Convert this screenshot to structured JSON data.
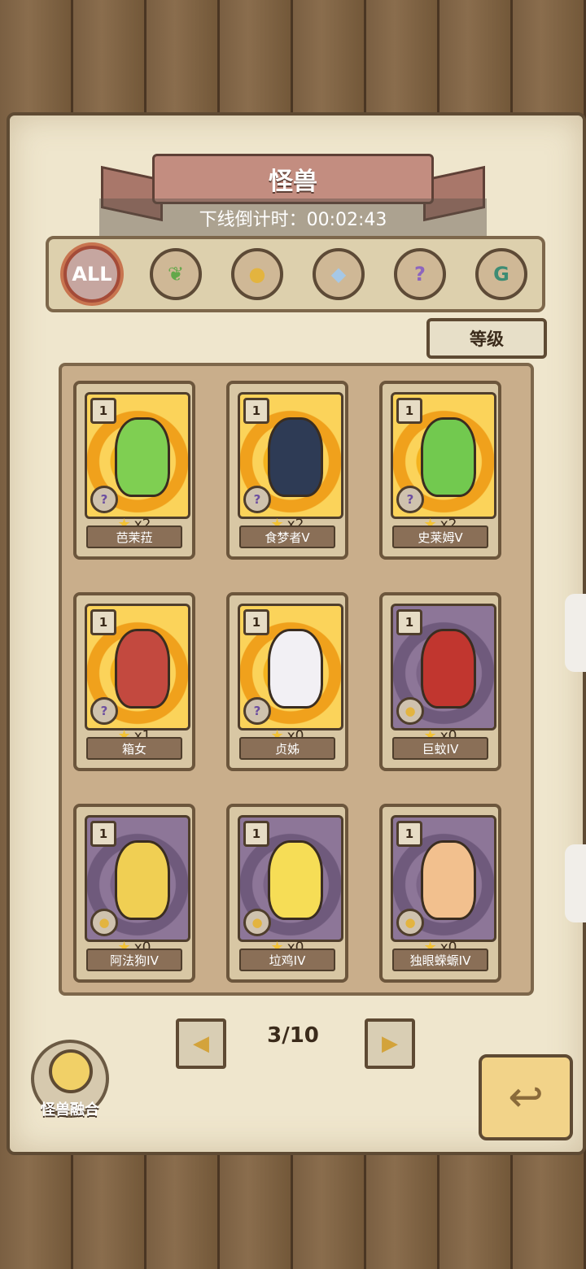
{
  "header": {
    "title": "怪兽",
    "countdown": "下线倒计时：00:02:43"
  },
  "filters": [
    {
      "label": "ALL",
      "icon": "all-icon",
      "active": true
    },
    {
      "label": "",
      "icon": "leaf-icon",
      "active": false
    },
    {
      "label": "",
      "icon": "paw-icon",
      "active": false
    },
    {
      "label": "",
      "icon": "crystal-icon",
      "active": false
    },
    {
      "label": "",
      "icon": "question-icon",
      "active": false
    },
    {
      "label": "",
      "icon": "green-gem-icon",
      "active": false
    }
  ],
  "sort": {
    "label": "等级"
  },
  "cards": [
    {
      "level": "1",
      "count": "x2",
      "name": "芭茉菈",
      "type": "?",
      "art": "gold",
      "color": "#7fcf52"
    },
    {
      "level": "1",
      "count": "x2",
      "name": "食梦者V",
      "type": "?",
      "art": "gold",
      "color": "#2e3b55"
    },
    {
      "level": "1",
      "count": "x2",
      "name": "史莱姆V",
      "type": "?",
      "art": "gold",
      "color": "#72c94f"
    },
    {
      "level": "1",
      "count": "x1",
      "name": "箱女",
      "type": "?",
      "art": "gold",
      "color": "#c3493f"
    },
    {
      "level": "1",
      "count": "x0",
      "name": "贞姊",
      "type": "?",
      "art": "gold",
      "color": "#f2f0f4"
    },
    {
      "level": "1",
      "count": "x0",
      "name": "巨蚊IV",
      "type": "paw",
      "art": "purple",
      "color": "#c1362f"
    },
    {
      "level": "1",
      "count": "x0",
      "name": "阿法狗IV",
      "type": "paw",
      "art": "purple",
      "color": "#f0cf53"
    },
    {
      "level": "1",
      "count": "x0",
      "name": "垃鸡IV",
      "type": "paw",
      "art": "purple",
      "color": "#f6dd56"
    },
    {
      "level": "1",
      "count": "x0",
      "name": "独眼蝾螈IV",
      "type": "paw",
      "art": "purple",
      "color": "#f2c08e"
    }
  ],
  "pagination": {
    "label": "3/10",
    "prev_icon": "triangle-left-icon",
    "next_icon": "triangle-right-icon"
  },
  "fusion": {
    "label": "怪兽融合"
  },
  "back_icon": "return-arrow-icon"
}
